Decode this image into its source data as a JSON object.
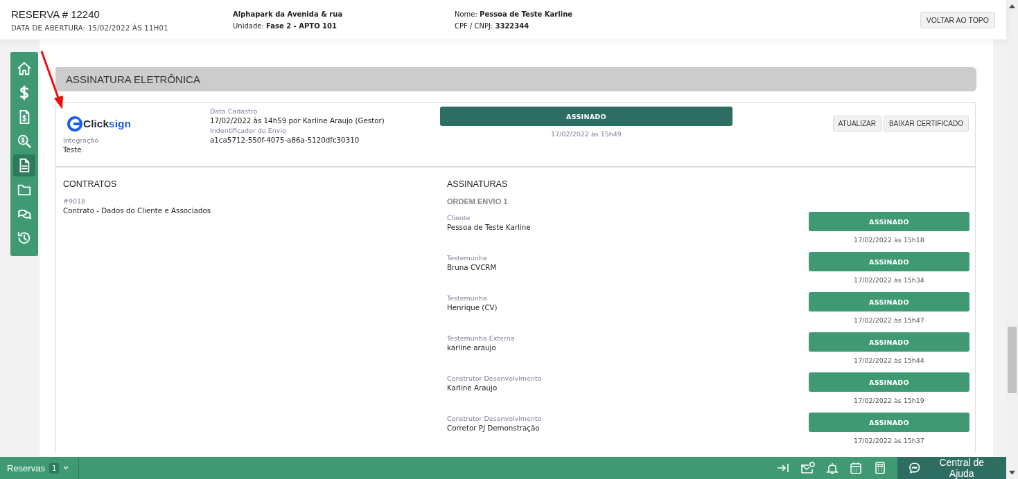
{
  "header": {
    "title": "RESERVA # 12240",
    "opened": "DATA DE ABERTURA: 15/02/2022 ÀS 11H01",
    "enterprise": "Alphapark da Avenida & rua",
    "unit_label": "Unidade:",
    "unit": "Fase 2 - APTO 101",
    "name_label": "Nome:",
    "name": "Pessoa de Teste Karline",
    "doc_label": "CPF / CNPJ:",
    "doc": "3322344",
    "back_button": "VOLTAR AO TOPO"
  },
  "sidebar": {
    "items": [
      {
        "kind": "home",
        "selected": false
      },
      {
        "kind": "dollar",
        "selected": false
      },
      {
        "kind": "invoice",
        "selected": false
      },
      {
        "kind": "search-money",
        "selected": false
      },
      {
        "kind": "document",
        "selected": true
      },
      {
        "kind": "folder",
        "selected": false
      },
      {
        "kind": "chat",
        "selected": false
      },
      {
        "kind": "history",
        "selected": false
      }
    ]
  },
  "section": {
    "title": "ASSINATURA ELETRÔNICA",
    "provider": {
      "logo_prefix": "Click",
      "logo_suffix": "sign",
      "integration_label": "Integração",
      "integration": "Teste"
    },
    "info": [
      {
        "label": "Data Cadastro",
        "value": "17/02/2022 às 14h59 por Karline Araujo (Gestor)"
      },
      {
        "label": "Indentificador do Envio",
        "value": "a1ca5712-550f-4075-a86a-5120dfc30310"
      }
    ],
    "status": {
      "label": "ASSINADO",
      "date": "17/02/2022 às 15h49"
    },
    "actions": [
      "ATUALIZAR",
      "BAIXAR CERTIFICADO"
    ],
    "contracts": {
      "title": "CONTRATOS",
      "items": [
        {
          "number": "#9018",
          "name": "Contrato - Dados do Cliente e Associados"
        }
      ]
    },
    "signatures": {
      "title": "ASSINATURAS",
      "order": "ORDEM ENVIO 1",
      "signers": [
        {
          "role": "Cliente",
          "name": "Pessoa de Teste Karline",
          "status": "ASSINADO",
          "date": "17/02/2022 às 15h18"
        },
        {
          "role": "Testemunha",
          "name": "Bruna CVCRM",
          "status": "ASSINADO",
          "date": "17/02/2022 às 15h34"
        },
        {
          "role": "Testemunha",
          "name": "Henrique (CV)",
          "status": "ASSINADO",
          "date": "17/02/2022 às 15h47"
        },
        {
          "role": "Testemunha Externa",
          "name": "karline araujo",
          "status": "ASSINADO",
          "date": "17/02/2022 às 15h44"
        },
        {
          "role": "Construtor Desenvolvimento",
          "name": "Karline Araujo",
          "status": "ASSINADO",
          "date": "17/02/2022 às 15h19"
        },
        {
          "role": "Construtor Desenvolvimento",
          "name": "Corretor PJ Demonstração",
          "status": "ASSINADO",
          "date": "17/02/2022 às 15h37"
        }
      ]
    }
  },
  "bottom_bar": {
    "tab": "Reservas",
    "count": "1",
    "help": "Central de Ajuda"
  }
}
